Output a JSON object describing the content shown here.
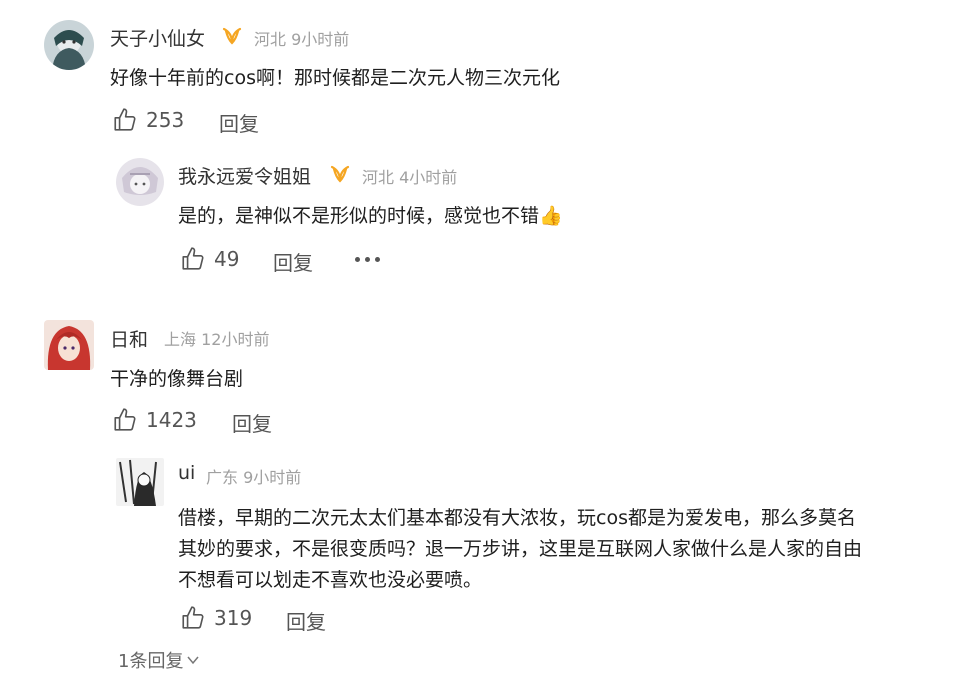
{
  "comments": [
    {
      "user": "天子小仙女",
      "location": "河北",
      "time": "9小时前",
      "text": "好像十年前的cos啊！那时候都是二次元人物三次元化",
      "likes": "253",
      "reply_label": "回复",
      "replies": [
        {
          "user": "我永远爱令姐姐",
          "location": "河北",
          "time": "4小时前",
          "text": "是的，是神似不是形似的时候，感觉也不错",
          "emoji": "👍",
          "likes": "49",
          "reply_label": "回复"
        }
      ]
    },
    {
      "user": "日和",
      "location": "上海",
      "time": "12小时前",
      "text": "干净的像舞台剧",
      "likes": "1423",
      "reply_label": "回复",
      "replies": [
        {
          "user": "ui",
          "location": "广东",
          "time": "9小时前",
          "text_lines": [
            "借楼，早期的二次元太太们基本都没有大浓妆，玩cos都是为爱发电，那么多莫名",
            "其妙的要求，不是很变质吗？退一万步讲，这里是互联网人家做什么是人家的自由",
            "不想看可以划走不喜欢也没必要喷。"
          ],
          "likes": "319",
          "reply_label": "回复"
        }
      ],
      "more_replies": "1条回复"
    }
  ],
  "icons": {
    "like": "thumbs-up-icon",
    "vip": "vip-badge-icon",
    "more": "more-dots-icon",
    "expand": "chevron-down-icon"
  },
  "colors": {
    "meta": "#a0a0a0",
    "vip_badge": "#f5a623",
    "text": "#1f1f1f"
  }
}
